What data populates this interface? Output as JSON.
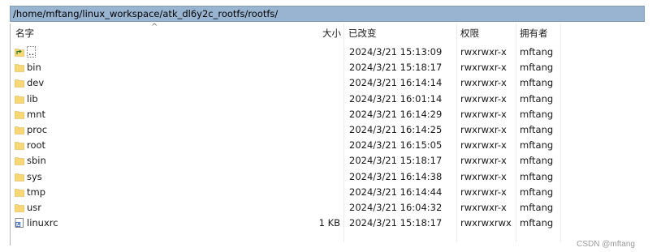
{
  "path_bar": {
    "path": "/home/mftang/linux_workspace/atk_dl6y2c_rootfs/rootfs/"
  },
  "columns": {
    "name": "名字",
    "size": "大小",
    "modified": "已改变",
    "permissions": "权限",
    "owner": "拥有者"
  },
  "files": [
    {
      "icon": "parent-folder-icon",
      "name": "..",
      "size": "",
      "modified": "2024/3/21 15:13:09",
      "permissions": "rwxrwxr-x",
      "owner": "mftang"
    },
    {
      "icon": "folder-icon",
      "name": "bin",
      "size": "",
      "modified": "2024/3/21 15:18:17",
      "permissions": "rwxrwxr-x",
      "owner": "mftang"
    },
    {
      "icon": "folder-icon",
      "name": "dev",
      "size": "",
      "modified": "2024/3/21 16:14:14",
      "permissions": "rwxrwxr-x",
      "owner": "mftang"
    },
    {
      "icon": "folder-icon",
      "name": "lib",
      "size": "",
      "modified": "2024/3/21 16:01:14",
      "permissions": "rwxrwxr-x",
      "owner": "mftang"
    },
    {
      "icon": "folder-icon",
      "name": "mnt",
      "size": "",
      "modified": "2024/3/21 16:14:29",
      "permissions": "rwxrwxr-x",
      "owner": "mftang"
    },
    {
      "icon": "folder-icon",
      "name": "proc",
      "size": "",
      "modified": "2024/3/21 16:14:25",
      "permissions": "rwxrwxr-x",
      "owner": "mftang"
    },
    {
      "icon": "folder-icon",
      "name": "root",
      "size": "",
      "modified": "2024/3/21 16:15:05",
      "permissions": "rwxrwxr-x",
      "owner": "mftang"
    },
    {
      "icon": "folder-icon",
      "name": "sbin",
      "size": "",
      "modified": "2024/3/21 15:18:17",
      "permissions": "rwxrwxr-x",
      "owner": "mftang"
    },
    {
      "icon": "folder-icon",
      "name": "sys",
      "size": "",
      "modified": "2024/3/21 16:14:38",
      "permissions": "rwxrwxr-x",
      "owner": "mftang"
    },
    {
      "icon": "folder-icon",
      "name": "tmp",
      "size": "",
      "modified": "2024/3/21 16:14:44",
      "permissions": "rwxrwxr-x",
      "owner": "mftang"
    },
    {
      "icon": "folder-icon",
      "name": "usr",
      "size": "",
      "modified": "2024/3/21 16:04:32",
      "permissions": "rwxrwxr-x",
      "owner": "mftang"
    },
    {
      "icon": "shortcut-file-icon",
      "name": "linuxrc",
      "size": "1 KB",
      "modified": "2024/3/21 15:18:17",
      "permissions": "rwxrwxrwx",
      "owner": "mftang"
    }
  ],
  "watermark": "CSDN @mftang",
  "colors": {
    "path_bar_bg": "#99b4d1",
    "folder": "#f8d775"
  }
}
